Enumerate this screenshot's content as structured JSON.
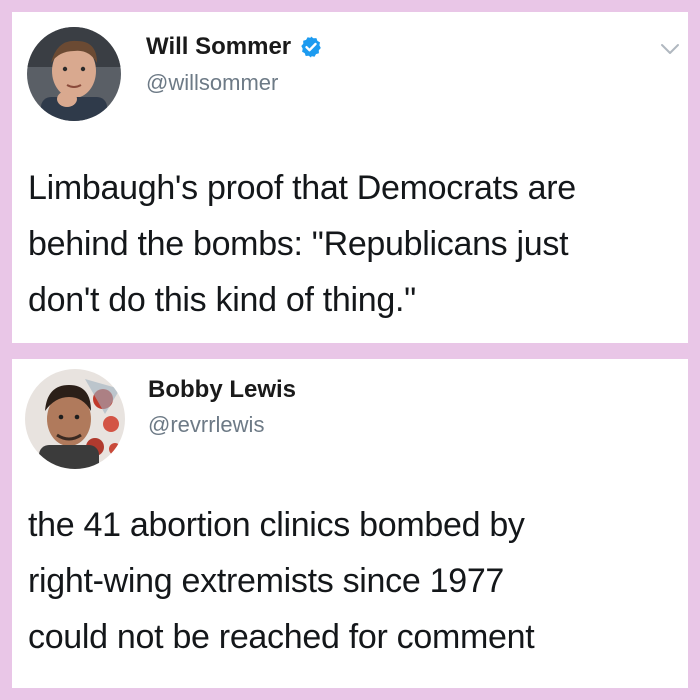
{
  "colors": {
    "page_background": "#e9c6e7",
    "card_background": "#ffffff",
    "handle_color": "#6d7a86",
    "verified_blue": "#1d9bf0"
  },
  "tweets": [
    {
      "display_name": "Will Sommer",
      "handle": "@willsommer",
      "verified": true,
      "icons": [
        "avatar",
        "verified-icon",
        "chevron-down-icon"
      ],
      "text_lines": [
        "Limbaugh's proof that Democrats are",
        "behind the bombs: \"Republicans just",
        "don't do this kind of thing.\""
      ]
    },
    {
      "display_name": "Bobby Lewis",
      "handle": "@revrrlewis",
      "verified": false,
      "icons": [
        "avatar"
      ],
      "text_lines": [
        "the 41 abortion clinics bombed by",
        "right-wing extremists since 1977",
        "could not be reached for comment"
      ]
    }
  ]
}
